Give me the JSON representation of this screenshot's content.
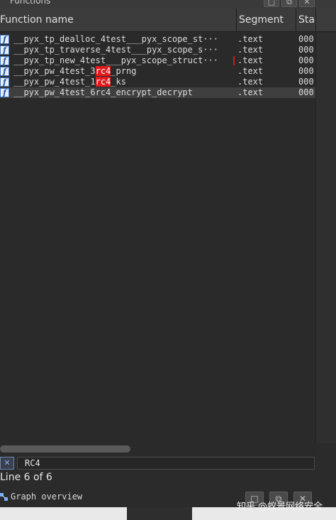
{
  "window": {
    "title": "Functions",
    "buttons": [
      "□",
      "⧉",
      "✕"
    ]
  },
  "table": {
    "columns": [
      "Function name",
      "Segment",
      "Start"
    ],
    "rows": [
      {
        "name": "__pyx_tp_dealloc_4test___pyx_scope_st···",
        "segment": ".text",
        "start": "000"
      },
      {
        "name": "__pyx_tp_traverse_4test___pyx_scope_s···",
        "segment": ".text",
        "start": "000"
      },
      {
        "name": "__pyx_tp_new_4test___pyx_scope_struct···",
        "segment": ".text",
        "start": "000"
      },
      {
        "name_pre": "__pyx_pw_4test_3",
        "name_hl": "rc4",
        "name_post": "_prng",
        "segment": ".text",
        "start": "000"
      },
      {
        "name_pre": "__pyx_pw_4test_1",
        "name_hl": "rc4",
        "name_post": "_ks",
        "segment": ".text",
        "start": "000"
      },
      {
        "name": "__pyx_pw_4test_6rc4_encrypt_decrypt",
        "segment": ".text",
        "start": "000"
      }
    ]
  },
  "search": {
    "close_label": "✕",
    "value": "RC4"
  },
  "status": "Line 6 of 6",
  "graph": {
    "title": "Graph overview",
    "buttons": [
      "□",
      "⧉",
      "✕"
    ]
  },
  "watermark": "知乎 @蚁景网络安全"
}
